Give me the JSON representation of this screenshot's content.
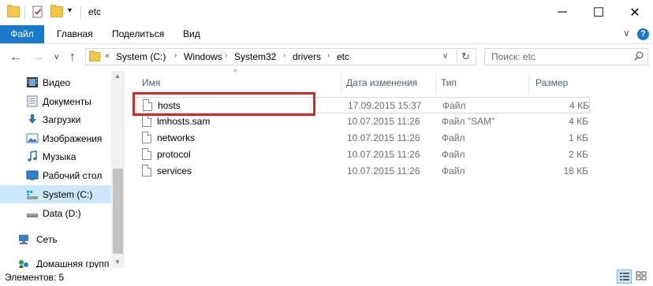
{
  "window": {
    "title": "etc",
    "buttons": {
      "minimize": "─",
      "maximize": "☐",
      "close": "✕"
    }
  },
  "ribbon": {
    "tabs": [
      {
        "label": "Файл"
      },
      {
        "label": "Главная"
      },
      {
        "label": "Поделиться"
      },
      {
        "label": "Вид"
      }
    ],
    "help": "?"
  },
  "navigation": {
    "back": "←",
    "forward": "→",
    "recent": "∨",
    "up": "↑",
    "breadcrumb_prefix": "«",
    "breadcrumbs": [
      "System (C:)",
      "Windows",
      "System32",
      "drivers",
      "etc"
    ],
    "dropdown": "∨",
    "refresh": "↻",
    "search_placeholder": "Поиск: etc"
  },
  "sidebar": {
    "items": [
      {
        "label": "Видео",
        "icon": "video-icon"
      },
      {
        "label": "Документы",
        "icon": "documents-icon"
      },
      {
        "label": "Загрузки",
        "icon": "downloads-icon"
      },
      {
        "label": "Изображения",
        "icon": "pictures-icon"
      },
      {
        "label": "Музыка",
        "icon": "music-icon"
      },
      {
        "label": "Рабочий стол",
        "icon": "desktop-icon"
      },
      {
        "label": "System (C:)",
        "icon": "drive-icon",
        "selected": true
      },
      {
        "label": "Data (D:)",
        "icon": "drive-icon"
      },
      {
        "label": "Сеть",
        "icon": "network-icon"
      },
      {
        "label": "Домашняя групп",
        "icon": "homegroup-icon"
      }
    ]
  },
  "filelist": {
    "columns": [
      "Имя",
      "Дата изменения",
      "Тип",
      "Размер"
    ],
    "sort_indicator": "^",
    "rows": [
      {
        "name": "hosts",
        "date": "17.09.2015 15:37",
        "type": "Файл",
        "size": "4 КБ"
      },
      {
        "name": "lmhosts.sam",
        "date": "10.07.2015 11:26",
        "type": "Файл \"SAM\"",
        "size": "4 КБ"
      },
      {
        "name": "networks",
        "date": "10.07.2015 11:26",
        "type": "Файл",
        "size": "1 КБ"
      },
      {
        "name": "protocol",
        "date": "10.07.2015 11:26",
        "type": "Файл",
        "size": "2 КБ"
      },
      {
        "name": "services",
        "date": "10.07.2015 11:26",
        "type": "Файл",
        "size": "18 КБ"
      }
    ]
  },
  "status": {
    "text": "Элементов: 5"
  },
  "colors": {
    "accent": "#1979ca",
    "selection": "#cce8ff",
    "highlight": "#d12a2a",
    "header_text": "#4c607a"
  }
}
